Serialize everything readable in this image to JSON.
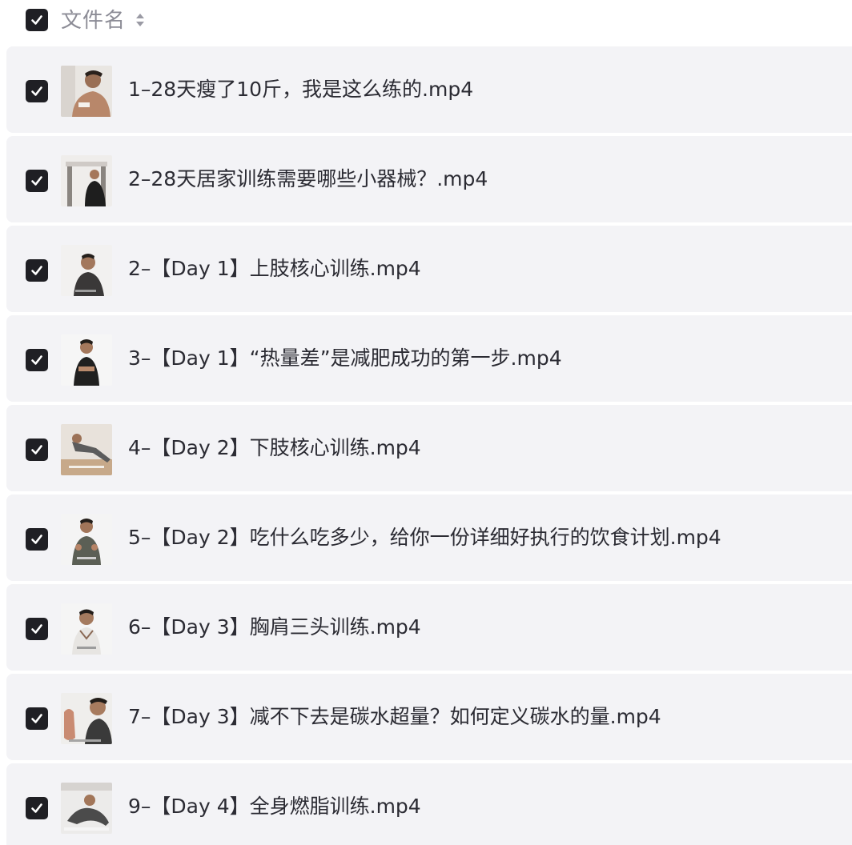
{
  "header": {
    "column_label": "文件名",
    "select_all_checked": true
  },
  "files": [
    {
      "name": "1–28天瘦了10斤，我是这么练的.mp4",
      "checked": true,
      "thumb_icon": "video-thumbnail"
    },
    {
      "name": "2–28天居家训练需要哪些小器械？.mp4",
      "checked": true,
      "thumb_icon": "video-thumbnail"
    },
    {
      "name": "2–【Day 1】上肢核心训练.mp4",
      "checked": true,
      "thumb_icon": "video-thumbnail"
    },
    {
      "name": "3–【Day 1】“热量差”是减肥成功的第一步.mp4",
      "checked": true,
      "thumb_icon": "video-thumbnail"
    },
    {
      "name": "4–【Day 2】下肢核心训练.mp4",
      "checked": true,
      "thumb_icon": "video-thumbnail"
    },
    {
      "name": "5–【Day 2】吃什么吃多少，给你一份详细好执行的饮食计划.mp4",
      "checked": true,
      "thumb_icon": "video-thumbnail"
    },
    {
      "name": "6–【Day 3】胸肩三头训练.mp4",
      "checked": true,
      "thumb_icon": "video-thumbnail"
    },
    {
      "name": "7–【Day 3】减不下去是碳水超量？如何定义碳水的量.mp4",
      "checked": true,
      "thumb_icon": "video-thumbnail"
    },
    {
      "name": "9–【Day 4】全身燃脂训练.mp4",
      "checked": true,
      "thumb_icon": "video-thumbnail"
    }
  ],
  "colors": {
    "row_background": "#f3f3f6",
    "checkbox_fill": "#1f1f24",
    "text_primary": "#2b2b33",
    "text_header": "#8c8c96"
  }
}
